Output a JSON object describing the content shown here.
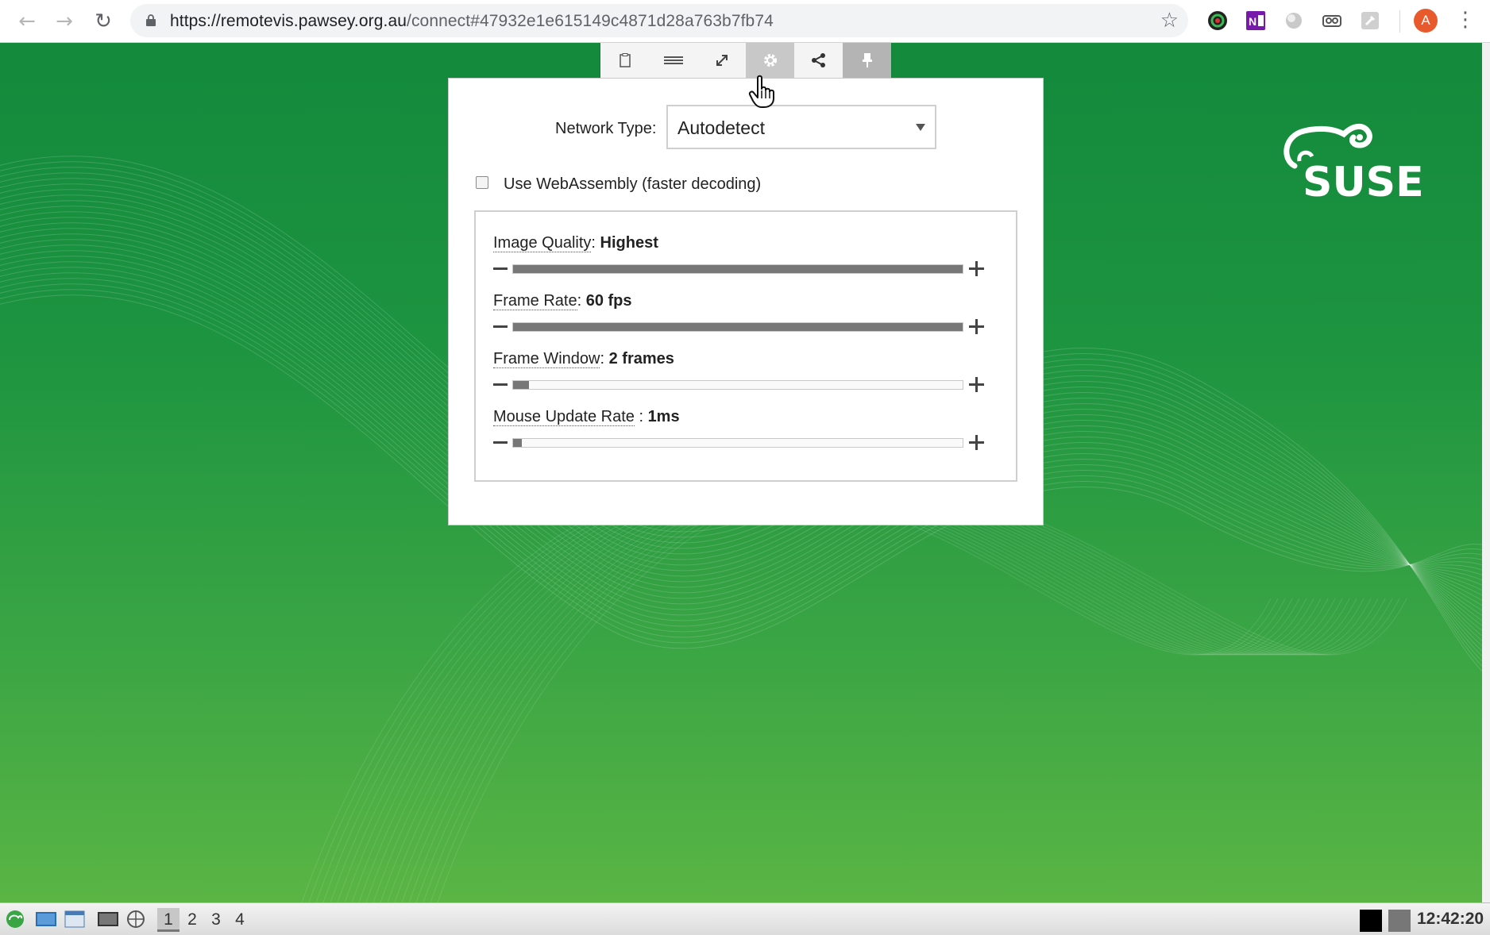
{
  "browser": {
    "url_host": "https://remotevis.pawsey.org.au",
    "url_path": "/connect#47932e1e615149c4871d28a763b7fb74",
    "avatar_letter": "A",
    "icons": [
      "back-icon",
      "forward-icon",
      "reload-icon",
      "lock-icon",
      "star-icon",
      "extensions",
      "menu-icon"
    ]
  },
  "remote_toolbar": {
    "buttons": [
      {
        "name": "clipboard-icon",
        "glyph": "▯",
        "state": "normal"
      },
      {
        "name": "menu-lines-icon",
        "glyph": "☰",
        "state": "normal"
      },
      {
        "name": "fullscreen-icon",
        "glyph": "⤢",
        "state": "normal"
      },
      {
        "name": "gear-icon",
        "glyph": "⚙",
        "state": "active"
      },
      {
        "name": "share-icon",
        "glyph": "⋖",
        "state": "normal"
      },
      {
        "name": "pin-icon",
        "glyph": "✎",
        "state": "pinned"
      }
    ]
  },
  "settings": {
    "network_type_label": "Network Type:",
    "network_type_value": "Autodetect",
    "webassembly_label": "Use WebAssembly (faster decoding)",
    "webassembly_checked": false,
    "sliders": [
      {
        "name": "Image Quality",
        "sep": ": ",
        "value": "Highest",
        "level": 1.0
      },
      {
        "name": "Frame Rate",
        "sep": ": ",
        "value": "60 fps",
        "level": 1.0
      },
      {
        "name": "Frame Window",
        "sep": ": ",
        "value": "2 frames",
        "level": 0.035
      },
      {
        "name": "Mouse Update Rate",
        "sep": " : ",
        "value": "1ms",
        "level": 0.02
      }
    ]
  },
  "desktop": {
    "brand": "SUSE",
    "accent": "#1d9440"
  },
  "taskbar": {
    "workspaces": [
      "1",
      "2",
      "3",
      "4"
    ],
    "active_workspace": 0,
    "clock": "12:42:20"
  }
}
